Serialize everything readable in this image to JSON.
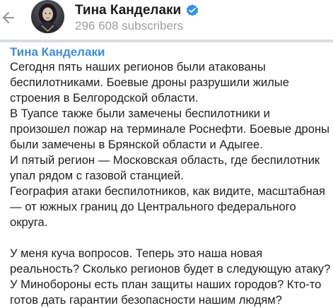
{
  "header": {
    "channel_name": "Тина Канделаки",
    "subscribers": "296 608 subscribers",
    "icons": {
      "back": "arrow-left-icon",
      "verified": "verified-badge-icon"
    },
    "colors": {
      "accent": "#3d8fd1",
      "verified": "#3390ec",
      "muted": "#9aa0a6"
    }
  },
  "post": {
    "author": "Тина Канделаки",
    "lines": [
      "Сегодня пять наших регионов были атакованы",
      "беспилотниками. Боевые дроны разрушили жилые",
      "строения в Белгородской области.",
      "В Туапсе также были замечены беспилотники и",
      "произошел пожар на терминале Роснефти. Боевые дроны",
      "были замечены в Брянской области и Адыгее.",
      "И пятый регион — Московская область, где беспилотник",
      "упал рядом с газовой станцией.",
      "География атаки беспилотников, как видите, масштабная",
      "— от южных границ до Центрального федерального",
      "округа.",
      "",
      "У меня куча вопросов. Теперь это наша новая",
      "реальность? Сколько регионов будет в следующую атаку?",
      "У Минобороны есть план защиты наших городов? Кто-то",
      "готов дать гарантии безопасности нашим людям?"
    ]
  }
}
